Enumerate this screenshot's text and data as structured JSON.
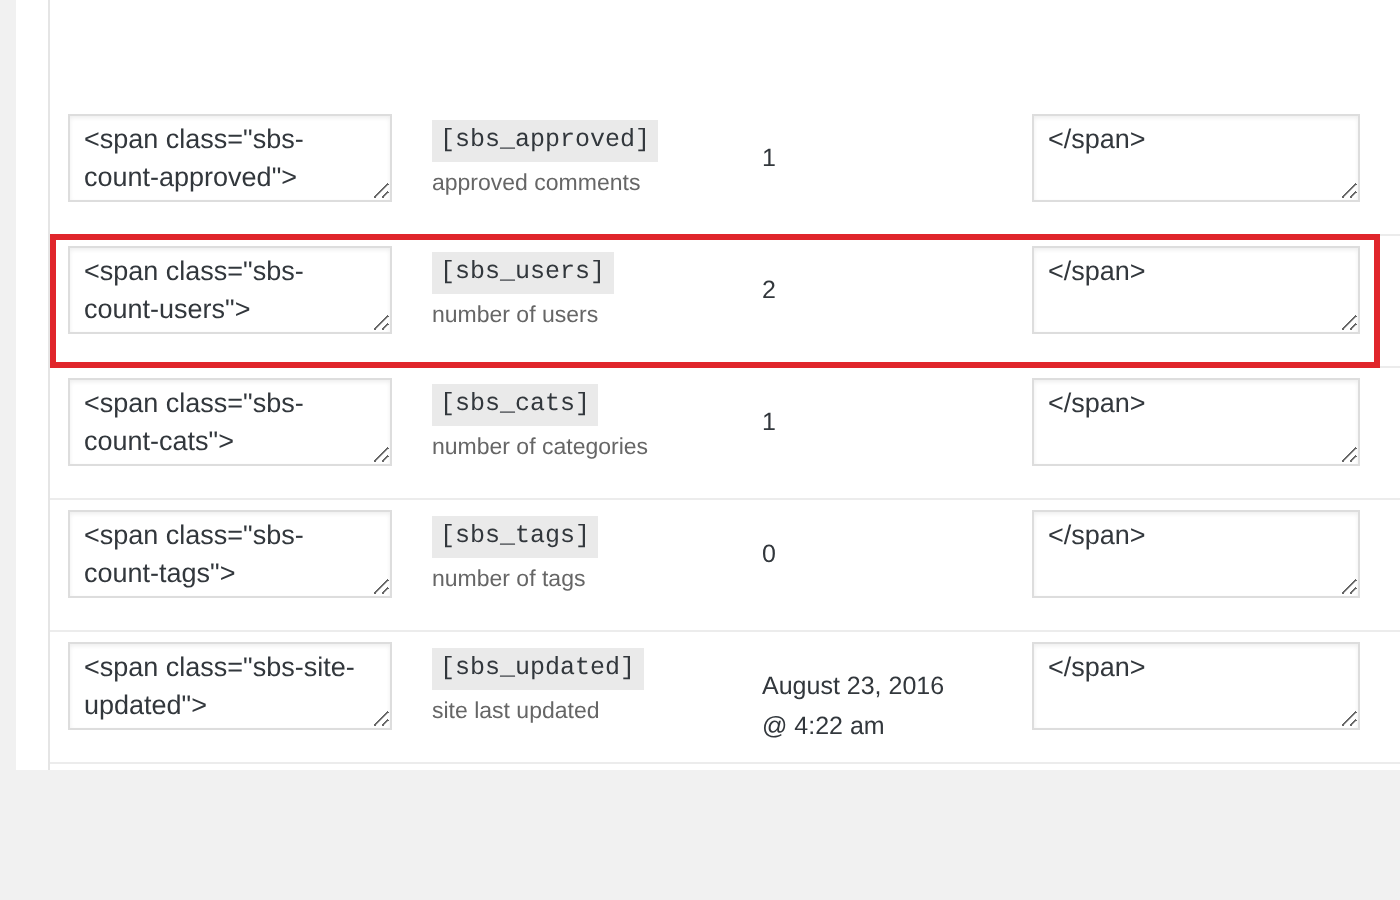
{
  "rows": [
    {
      "before": "<span class=\"sbs-count-approved\">",
      "shortcode": "[sbs_approved]",
      "description": "approved comments",
      "value": "1",
      "after": "</span>",
      "highlighted": false
    },
    {
      "before": "<span class=\"sbs-count-users\">",
      "shortcode": "[sbs_users]",
      "description": "number of users",
      "value": "2",
      "after": "</span>",
      "highlighted": true
    },
    {
      "before": "<span class=\"sbs-count-cats\">",
      "shortcode": "[sbs_cats]",
      "description": "number of categories",
      "value": "1",
      "after": "</span>",
      "highlighted": false
    },
    {
      "before": "<span class=\"sbs-count-tags\">",
      "shortcode": "[sbs_tags]",
      "description": "number of tags",
      "value": "0",
      "after": "</span>",
      "highlighted": false
    },
    {
      "before": "<span class=\"sbs-site-updated\">",
      "shortcode": "[sbs_updated]",
      "description": "site last updated",
      "value": "August 23, 2016\n@ 4:22 am",
      "after": "</span>",
      "highlighted": false
    }
  ]
}
